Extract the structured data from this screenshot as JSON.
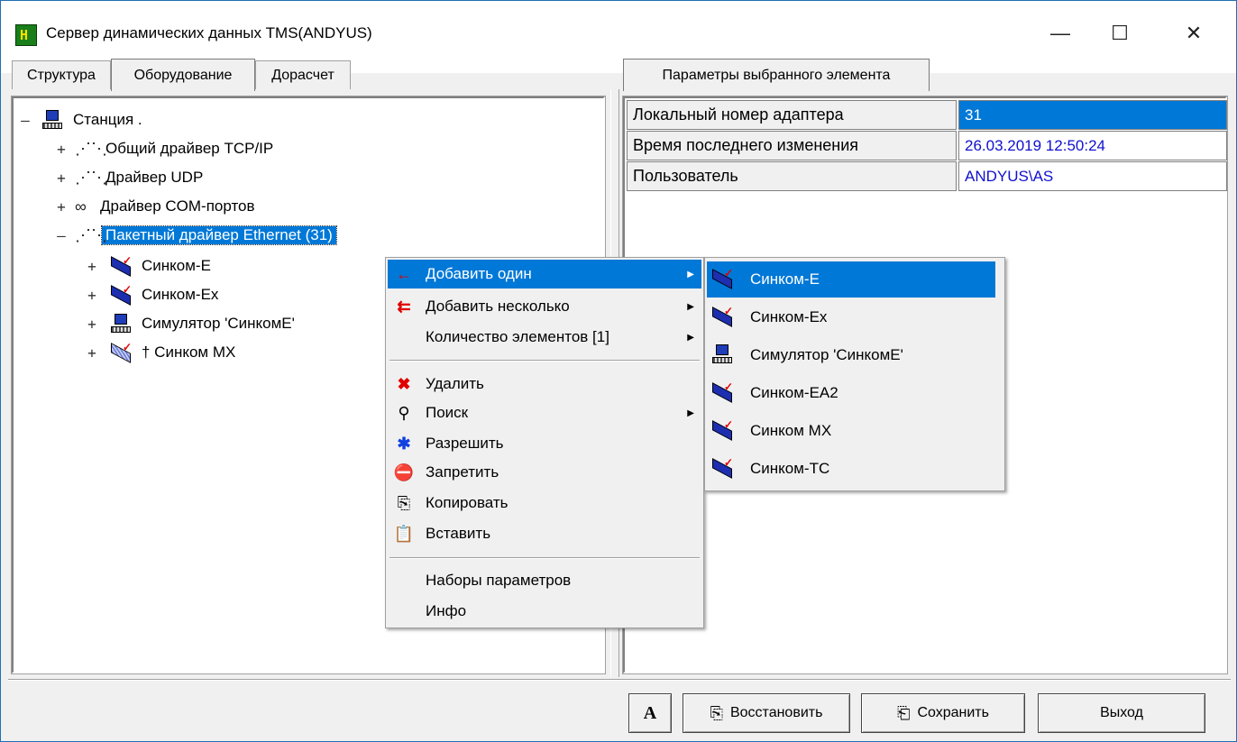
{
  "window": {
    "title": "Сервер динамических данных TMS(ANDYUS)",
    "minimize_glyph": "—",
    "maximize_glyph": "☐",
    "close_glyph": "✕"
  },
  "left_tabs": [
    {
      "label": "Структура",
      "active": false
    },
    {
      "label": "Оборудование",
      "active": true
    },
    {
      "label": "Дорасчет",
      "active": false
    }
  ],
  "right_tab": {
    "label": "Параметры выбранного элемента"
  },
  "tree": {
    "root": {
      "label": "Станция .",
      "expander": "–",
      "icon": "computer-icon"
    },
    "drivers": [
      {
        "label": "Общий драйвер TCP/IP",
        "expander": "+",
        "icon": "network-icon"
      },
      {
        "label": "Драйвер UDP",
        "expander": "+",
        "icon": "network-icon"
      },
      {
        "label": "Драйвер COM-портов",
        "expander": "+",
        "icon": "com-port-icon"
      },
      {
        "label": "Пакетный драйвер Ethernet  (31)",
        "expander": "–",
        "icon": "network-icon",
        "selected": true
      }
    ],
    "devices": [
      {
        "label": "Синком-Е",
        "expander": "+",
        "icon": "device-icon"
      },
      {
        "label": "Синком-Ех",
        "expander": "+",
        "icon": "device-icon"
      },
      {
        "label": "Симулятор 'СинкомЕ'",
        "expander": "+",
        "icon": "computer-icon"
      },
      {
        "label": "† Синком МХ",
        "expander": "+",
        "icon": "device-disabled-icon"
      }
    ]
  },
  "properties": [
    {
      "name": "Локальный номер адаптера",
      "value": "31",
      "selected": true
    },
    {
      "name": "Время последнего изменения",
      "value": "26.03.2019 12:50:24",
      "selected": false
    },
    {
      "name": "Пользователь",
      "value": "ANDYUS\\AS",
      "selected": false
    }
  ],
  "context_menu": {
    "items": [
      {
        "label": "Добавить один",
        "icon": "arrow-left-icon",
        "submenu": true,
        "highlighted": true
      },
      {
        "label": "Добавить несколько",
        "icon": "double-arrow-left-icon",
        "submenu": true
      },
      {
        "label": "Количество элементов [1]",
        "icon": "",
        "submenu": true
      },
      {
        "label": "Удалить",
        "icon": "delete-icon"
      },
      {
        "label": "Поиск",
        "icon": "search-icon",
        "submenu": true
      },
      {
        "label": "Разрешить",
        "icon": "enable-icon"
      },
      {
        "label": "Запретить",
        "icon": "forbid-icon"
      },
      {
        "label": "Копировать",
        "icon": "copy-icon"
      },
      {
        "label": "Вставить",
        "icon": "paste-icon"
      },
      {
        "label": "Наборы параметров",
        "icon": ""
      },
      {
        "label": "Инфо",
        "icon": ""
      }
    ]
  },
  "submenu": {
    "items": [
      {
        "label": "Синком-Е",
        "highlighted": true
      },
      {
        "label": "Синком-Ех"
      },
      {
        "label": "Симулятор 'СинкомЕ'"
      },
      {
        "label": "Синком-ЕА2"
      },
      {
        "label": "Синком МХ"
      },
      {
        "label": "Синком-ТС"
      }
    ]
  },
  "bottom": {
    "font_button": "A",
    "restore_label": "Восстановить",
    "save_label": "Сохранить",
    "exit_label": "Выход"
  },
  "colors": {
    "selection": "#0078d7",
    "value_text": "#1010d0"
  }
}
